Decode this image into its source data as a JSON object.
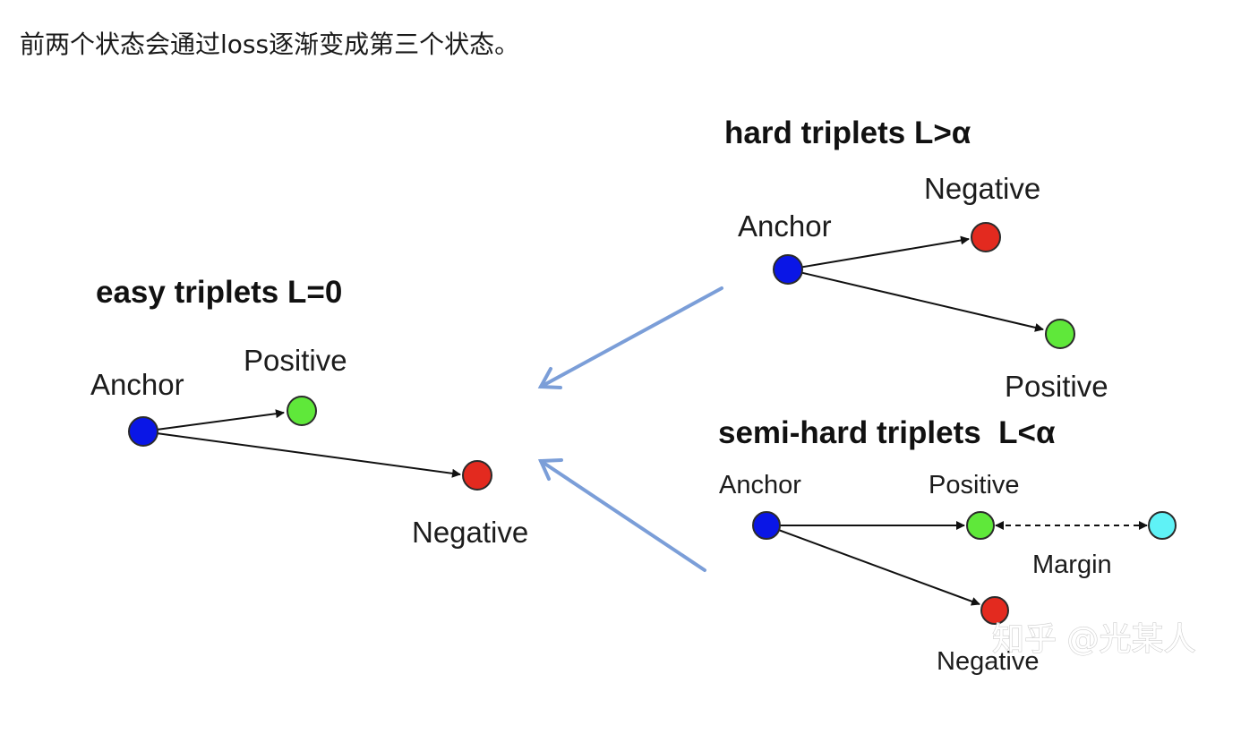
{
  "intro_text": "前两个状态会通过loss逐渐变成第三个状态。",
  "colors": {
    "anchor": "#0a16e6",
    "positive": "#5fe83a",
    "negative": "#e32a1f",
    "margin_point": "#5ff2f6",
    "transition_arrow": "#7b9ed8"
  },
  "easy": {
    "title": "easy triplets L=0",
    "anchor_label": "Anchor",
    "positive_label": "Positive",
    "negative_label": "Negative"
  },
  "hard": {
    "title": "hard triplets L>α",
    "anchor_label": "Anchor",
    "negative_label": "Negative",
    "positive_label": "Positive"
  },
  "semi_hard": {
    "title": "semi-hard triplets  L<α",
    "anchor_label": "Anchor",
    "positive_label": "Positive",
    "negative_label": "Negative",
    "margin_label": "Margin"
  },
  "watermark": "知乎 @光某人"
}
